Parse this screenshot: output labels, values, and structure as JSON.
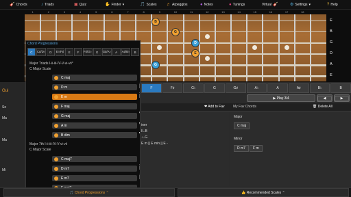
{
  "nav": {
    "chords": "Chords",
    "triads": "Triads",
    "quiz": "Quiz",
    "finder": "Finder",
    "scales": "Scales",
    "arpeggios": "Arpeggios",
    "notes": "Notes",
    "tunings": "Tunings",
    "virtual": "Virtual",
    "settings": "Settings",
    "help": "Help"
  },
  "fret_numbers": [
    "1",
    "2",
    "3",
    "4",
    "5",
    "6",
    "7",
    "8",
    "9",
    "10",
    "11",
    "12",
    "13",
    "14",
    "15",
    "16",
    "17",
    "18"
  ],
  "strings": [
    "E",
    "B",
    "G",
    "D",
    "A",
    "E"
  ],
  "notes": [
    "B",
    "G",
    "D",
    "E",
    "G"
  ],
  "key_buttons": [
    "F",
    "F♯",
    "G♭",
    "G",
    "G♯",
    "A♭",
    "A",
    "A♯",
    "B♭",
    "B"
  ],
  "play_label": "▶ Play 3/4",
  "arrow_prev": "◀",
  "arrow_next": "▶",
  "add_to_fav": "❤ Add to Fav",
  "my_fav_chords": "My Fav Chords",
  "delete_all": "🗑 Delete All",
  "mid": {
    "line1": "iner",
    "line2": "II..B",
    "line3": "↓..G",
    "line4": "E m || E min || E -"
  },
  "right": {
    "major": "Major",
    "chip_cmaj": "C maj",
    "minor": "Minor",
    "chip_dm7": "D m7",
    "chip_fm": "F m"
  },
  "left": {
    "g": "Gui",
    "m1": "Ma",
    "m2": "Ma",
    "s": "Se",
    "m3": "Mi"
  },
  "bottom": {
    "chord_prog": "🎵 Chord Progressions ⌃",
    "rec_scales": "👍 Recommended Scales ⌃"
  },
  "popup": {
    "title": "Chord Progressions",
    "keys": [
      "C",
      "C♯/D♭",
      "D",
      "E♭/F♯",
      "E",
      "F",
      "F♯/G♭",
      "G",
      "G♯/A♭",
      "A",
      "A♯/B♭",
      "B"
    ],
    "sec1_line1": "Major Triads I-ii-iii-IV-V-vi-vii°",
    "sec1_line2": "C Major Scale",
    "triads": [
      {
        "label": "C maj",
        "roman": "I"
      },
      {
        "label": "D m",
        "roman": "ii"
      },
      {
        "label": "E m",
        "roman": "iii"
      },
      {
        "label": "F maj",
        "roman": "IV"
      },
      {
        "label": "G maj",
        "roman": "V"
      },
      {
        "label": "A m",
        "roman": "vi"
      },
      {
        "label": "B dim",
        "roman": "vii°"
      }
    ],
    "sec2_line1": "Major 7th I-ii-iii-IV-V-vi-vii",
    "sec2_line2": "C Major Scale",
    "sevenths": [
      {
        "label": "C maj7",
        "roman": "I"
      },
      {
        "label": "D m7",
        "roman": "ii"
      },
      {
        "label": "E m7",
        "roman": "iii"
      },
      {
        "label": "F maj7",
        "roman": "IV"
      }
    ]
  },
  "colors": {
    "accent_orange": "#f0a030",
    "accent_blue": "#3aa0d8",
    "active_row": "#d87a15"
  }
}
